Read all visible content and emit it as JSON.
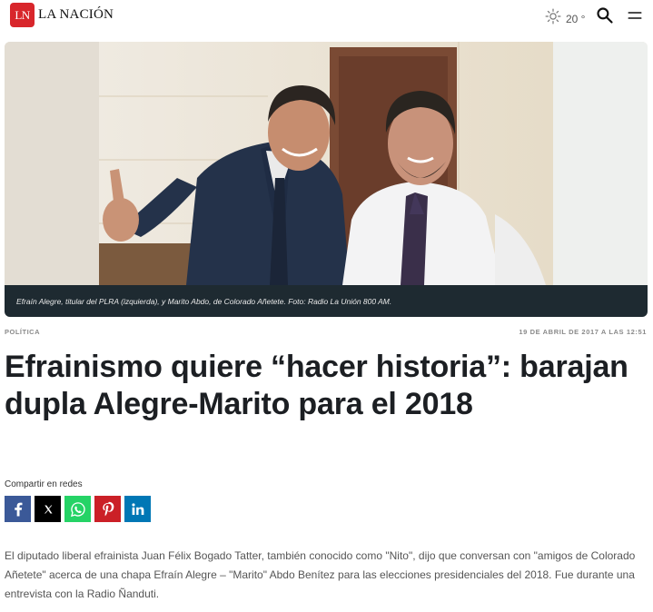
{
  "header": {
    "logo_mark": "LN",
    "logo_text": "LA NACIÓN",
    "weather_temp": "20 °",
    "weather_icon": "sun-icon",
    "search_icon": "search-icon",
    "menu_icon": "menu-icon"
  },
  "hero": {
    "caption": "Efraín Alegre, titular del PLRA (izquierda), y Marito Abdo, de Colorado Añetete. Foto: Radio La Unión 800 AM."
  },
  "article": {
    "section": "POLÍTICA",
    "date": "19 DE ABRIL DE 2017 A LAS 12:51",
    "headline": "Efrainismo quiere “hacer historia”: barajan dupla Alegre-Marito para el 2018",
    "share_label": "Compartir en redes",
    "share_buttons": [
      {
        "name": "facebook",
        "color": "#3b5998",
        "icon": "facebook-icon"
      },
      {
        "name": "x",
        "color": "#000000",
        "icon": "x-icon"
      },
      {
        "name": "whatsapp",
        "color": "#25d366",
        "icon": "whatsapp-icon"
      },
      {
        "name": "pinterest",
        "color": "#cb2027",
        "icon": "pinterest-icon"
      },
      {
        "name": "linkedin",
        "color": "#0077b5",
        "icon": "linkedin-icon"
      }
    ],
    "body": "El diputado liberal efrainista Juan Félix Bogado Tatter, también conocido como \"Nito\", dijo que conversan con \"amigos de Colorado Añetete\" acerca de una chapa Efraín Alegre – \"Marito\" Abdo Benítez para las elecciones presidenciales del 2018. Fue durante una entrevista con la Radio Ñanduti."
  },
  "colors": {
    "brand_red": "#d8262b",
    "caption_bg": "#1e2a31",
    "headline": "#1c1f23"
  }
}
